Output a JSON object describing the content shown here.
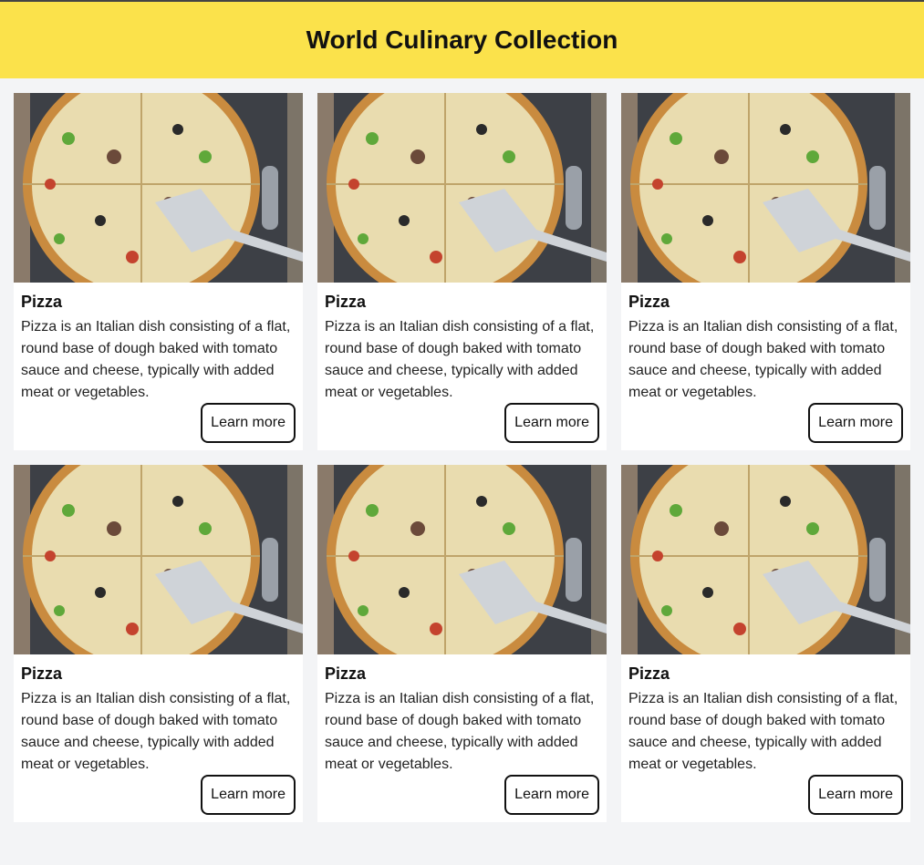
{
  "header": {
    "title": "World Culinary Collection"
  },
  "colors": {
    "header_bg": "#fbe24b",
    "page_bg": "#f3f4f6",
    "card_bg": "#ffffff"
  },
  "cards": [
    {
      "title": "Pizza",
      "description": "Pizza is an Italian dish consisting of a flat, round base of dough baked with tomato sauce and cheese, typically with added meat or vegetables.",
      "button_label": "Learn more",
      "image_alt": "Pizza"
    },
    {
      "title": "Pizza",
      "description": "Pizza is an Italian dish consisting of a flat, round base of dough baked with tomato sauce and cheese, typically with added meat or vegetables.",
      "button_label": "Learn more",
      "image_alt": "Pizza"
    },
    {
      "title": "Pizza",
      "description": "Pizza is an Italian dish consisting of a flat, round base of dough baked with tomato sauce and cheese, typically with added meat or vegetables.",
      "button_label": "Learn more",
      "image_alt": "Pizza"
    },
    {
      "title": "Pizza",
      "description": "Pizza is an Italian dish consisting of a flat, round base of dough baked with tomato sauce and cheese, typically with added meat or vegetables.",
      "button_label": "Learn more",
      "image_alt": "Pizza"
    },
    {
      "title": "Pizza",
      "description": "Pizza is an Italian dish consisting of a flat, round base of dough baked with tomato sauce and cheese, typically with added meat or vegetables.",
      "button_label": "Learn more",
      "image_alt": "Pizza"
    },
    {
      "title": "Pizza",
      "description": "Pizza is an Italian dish consisting of a flat, round base of dough baked with tomato sauce and cheese, typically with added meat or vegetables.",
      "button_label": "Learn more",
      "image_alt": "Pizza"
    }
  ]
}
